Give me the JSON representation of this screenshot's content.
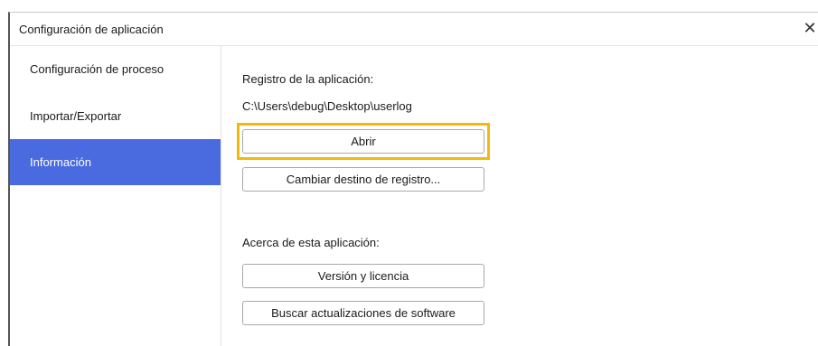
{
  "window": {
    "title": "Configuración de aplicación",
    "close_glyph": "✕"
  },
  "sidebar": {
    "items": [
      {
        "label": "Configuración de proceso",
        "active": false
      },
      {
        "label": "Importar/Exportar",
        "active": false
      },
      {
        "label": "Información",
        "active": true
      }
    ]
  },
  "log_section": {
    "heading": "Registro de la aplicación:",
    "path": "C:\\Users\\debug\\Desktop\\userlog",
    "open_button": "Abrir",
    "change_button": "Cambiar destino de registro..."
  },
  "about_section": {
    "heading": "Acerca de esta aplicación:",
    "version_button": "Versión y licencia",
    "updates_button": "Buscar actualizaciones de software"
  },
  "colors": {
    "active_nav": "#4a6ae0",
    "highlight": "#f2b90d"
  }
}
